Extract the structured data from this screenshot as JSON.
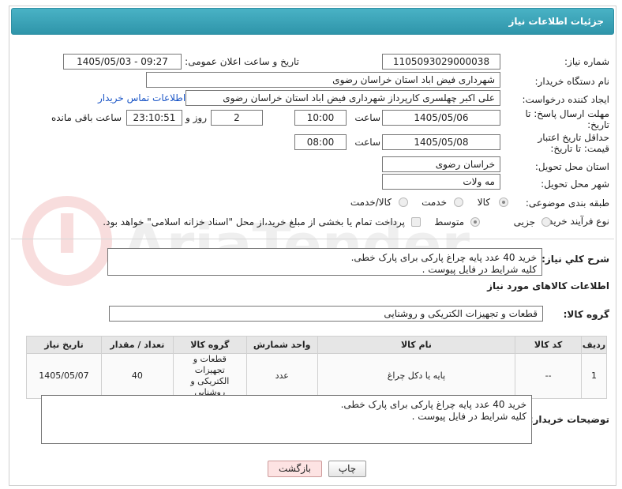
{
  "header": {
    "title": "جزئیات اطلاعات نیاز"
  },
  "form": {
    "need_number": {
      "label": "شماره نیاز:",
      "value": "1105093029000038"
    },
    "announce": {
      "label": "تاریخ و ساعت اعلان عمومی:",
      "value": "1405/05/03 - 09:27"
    },
    "buyer_org": {
      "label": "نام دستگاه خریدار:",
      "value": "شهرداری فیض اباد استان خراسان رضوی"
    },
    "creator": {
      "label": "ایجاد کننده درخواست:",
      "value": "علی اکبر چهلسری کارپرداز شهرداری فیض اباد استان خراسان رضوی",
      "contact_link": "اطلاعات تماس خریدار"
    },
    "reply_deadline": {
      "label": "مهلت ارسال پاسخ: تا تاریخ:",
      "date": "1405/05/06",
      "time_label": "ساعت",
      "time": "10:00",
      "days": "2",
      "days_label": "روز و",
      "remaining": "23:10:51",
      "remaining_label": "ساعت باقی مانده"
    },
    "price_validity": {
      "label": "حداقل تاریخ اعتبار قیمت: تا تاریخ:",
      "date": "1405/05/08",
      "time_label": "ساعت",
      "time": "08:00"
    },
    "delivery_province": {
      "label": "استان محل تحویل:",
      "value": "خراسان رضوی"
    },
    "delivery_city": {
      "label": "شهر محل تحویل:",
      "value": "مه ولات"
    },
    "category": {
      "label": "طبقه بندی موضوعی:",
      "options": [
        "کالا",
        "خدمت",
        "کالا/خدمت"
      ]
    },
    "process": {
      "label": "نوع فرآیند خرید :",
      "options": [
        "جزیی",
        "متوسط"
      ],
      "payment_note": "پرداخت تمام یا بخشی از مبلغ خرید،از محل \"اسناد خزانه اسلامی\" خواهد بود."
    }
  },
  "summary": {
    "label": "شرح کلي نياز:",
    "text": "خرید 40 عدد پایه چراغ پارکی برای پارک خطی.\nکلیه شرایط در فایل پیوست ."
  },
  "goods": {
    "section_title": "اطلاعات کالاهای مورد نیاز",
    "group_label": "گروه کالا:",
    "group_value": "قطعات و تجهیزات الکتریکی و روشنایی",
    "columns": [
      "ردیف",
      "کد کالا",
      "نام کالا",
      "واحد شمارش",
      "گروه کالا",
      "تعداد / مقدار",
      "تاریخ نیاز"
    ],
    "rows": [
      {
        "row": "1",
        "code": "--",
        "name": "پایه یا دکل چراغ",
        "unit": "عدد",
        "group": "قطعات و تجهیزات الکتریکی و روشنایی",
        "qty": "40",
        "date": "1405/05/07"
      }
    ]
  },
  "buyer_notes": {
    "label": "توضیحات خریدار:",
    "text": "خرید 40 عدد پایه چراغ پارکی برای پارک خطی.\nکلیه شرایط در فایل پیوست ."
  },
  "buttons": {
    "print": "چاپ",
    "back": "بازگشت"
  },
  "watermark": {
    "text": "AriaTender.net"
  }
}
